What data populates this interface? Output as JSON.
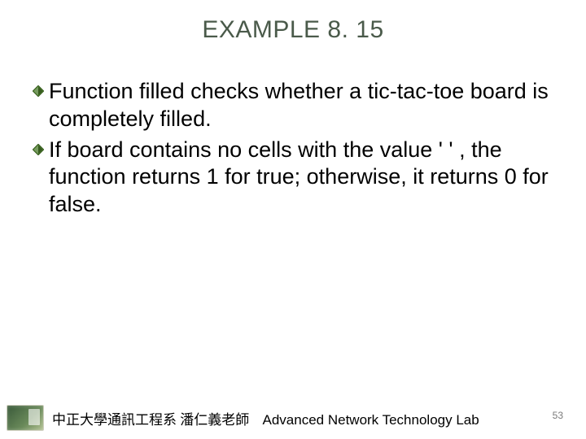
{
  "title": "EXAMPLE 8. 15",
  "bullets": [
    "Function filled checks whether a tic-tac-toe board is completely filled.",
    "If board contains no cells with the value ' ' , the function returns 1 for true; otherwise, it returns 0 for false."
  ],
  "footer": {
    "org": "中正大學通訊工程系 潘仁義老師",
    "lab": "Advanced Network Technology Lab"
  },
  "page_number": "53",
  "colors": {
    "title": "#4a5a4a",
    "bullet_fill": "#4a7a2a"
  }
}
